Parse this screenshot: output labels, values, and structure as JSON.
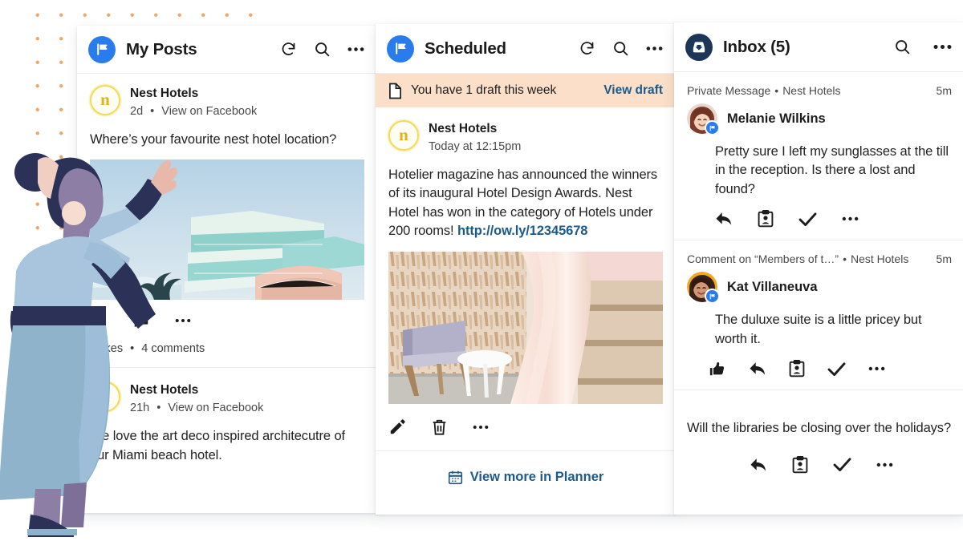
{
  "colors": {
    "brand_blue": "#2a7ced",
    "navy": "#1d3557",
    "link_blue": "#1b5a8c",
    "banner_peach": "#fbdfc9",
    "dot_orange": "#f0a868",
    "nest_gold": "#e0b31c"
  },
  "panels": {
    "my_posts": {
      "title": "My Posts",
      "brand_icon": "flag-icon",
      "header_icons": [
        "refresh-icon",
        "search-icon",
        "more-icon"
      ],
      "posts": [
        {
          "author": "Nest Hotels",
          "avatar_letter": "n",
          "time": "2d",
          "source_link": "View on Facebook",
          "body": "Where’s your favourite nest hotel location?",
          "image": "art-deco-hotel-photo",
          "actions": [
            "like-icon",
            "comment-icon",
            "more-icon"
          ],
          "stats_likes": "2 likes",
          "stats_comments": "4 comments",
          "stats_sep": "•"
        },
        {
          "author": "Nest Hotels",
          "avatar_letter": "n",
          "time": "21h",
          "source_link": "View on Facebook",
          "body": "We love the art deco inspired architecutre of our Miami beach hotel."
        }
      ]
    },
    "scheduled": {
      "title": "Scheduled",
      "brand_icon": "flag-icon",
      "header_icons": [
        "refresh-icon",
        "search-icon",
        "more-icon"
      ],
      "draft_banner": {
        "icon": "document-icon",
        "text": "You have 1 draft this week",
        "link": "View draft"
      },
      "post": {
        "author": "Nest Hotels",
        "avatar_letter": "n",
        "time": "Today at 12:15pm",
        "body_text": "Hotelier magazine has announced the winners of its inaugural Hotel Design Awards. Nest Hotel has won in the category of Hotels under 200 rooms! ",
        "body_link": "http://ow.ly/12345678",
        "image": "hotel-interior-photo",
        "actions": [
          "edit-icon",
          "delete-icon",
          "more-icon"
        ]
      },
      "footer": {
        "icon": "calendar-icon",
        "label": "View more in Planner"
      }
    },
    "inbox": {
      "title": "Inbox (5)",
      "brand_icon": "inbox-icon",
      "header_icons": [
        "search-icon",
        "more-icon"
      ],
      "items": [
        {
          "type": "Private Message",
          "sep": "•",
          "account": "Nest Hotels",
          "time": "5m",
          "sender": "Melanie Wilkins",
          "badge_icon": "facebook-flag-badge",
          "message": "Pretty sure I left my sunglasses at the till in the reception. Is there a lost and found?",
          "actions": [
            "reply-icon",
            "assign-icon",
            "resolve-icon",
            "more-icon"
          ]
        },
        {
          "type": "Comment on “Members of t…”",
          "sep": "•",
          "account": "Nest Hotels",
          "time": "5m",
          "sender": "Kat Villaneuva",
          "badge_icon": "facebook-flag-badge",
          "message": "The duluxe suite is a little pricey but worth it.",
          "actions": [
            "like-icon",
            "reply-icon",
            "assign-icon",
            "resolve-icon",
            "more-icon"
          ]
        },
        {
          "message": "Will the libraries be closing over the holidays?",
          "actions": [
            "reply-icon",
            "assign-icon",
            "resolve-icon",
            "more-icon"
          ]
        }
      ]
    }
  }
}
